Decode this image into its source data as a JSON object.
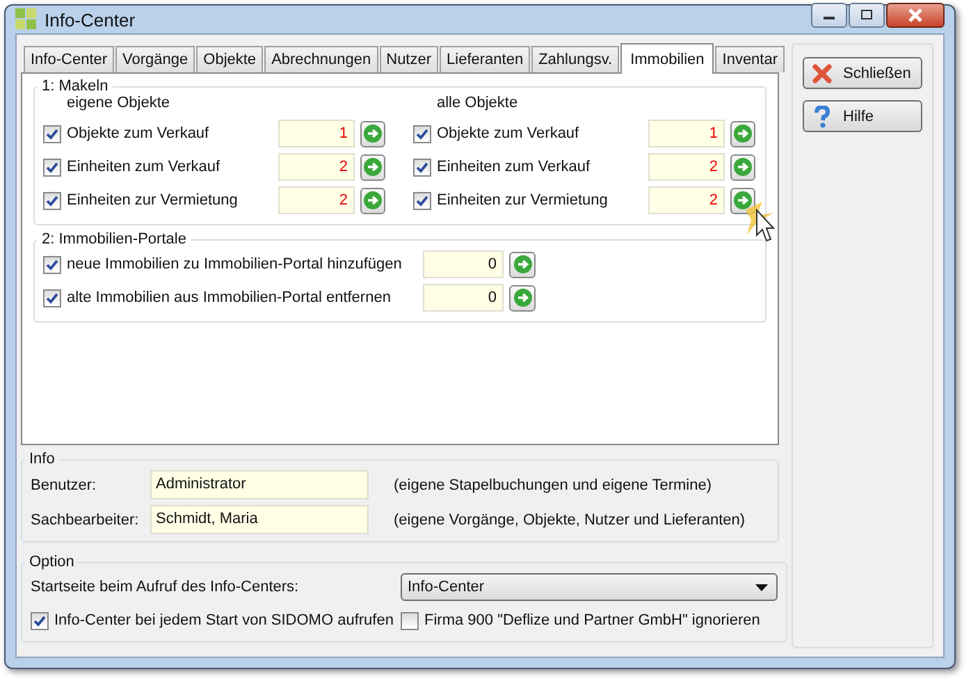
{
  "window": {
    "title": "Info-Center"
  },
  "tabs": [
    {
      "label": "Info-Center",
      "selected": false
    },
    {
      "label": "Vorgänge",
      "selected": false
    },
    {
      "label": "Objekte",
      "selected": false
    },
    {
      "label": "Abrechnungen",
      "selected": false
    },
    {
      "label": "Nutzer",
      "selected": false
    },
    {
      "label": "Lieferanten",
      "selected": false
    },
    {
      "label": "Zahlungsv.",
      "selected": false
    },
    {
      "label": "Immobilien",
      "selected": true
    },
    {
      "label": "Inventar",
      "selected": false
    }
  ],
  "makeln": {
    "title": "1: Makeln",
    "columns": [
      {
        "heading": "eigene Objekte",
        "rows": [
          {
            "label": "Objekte zum Verkauf",
            "checked": true,
            "value": "1"
          },
          {
            "label": "Einheiten zum Verkauf",
            "checked": true,
            "value": "2"
          },
          {
            "label": "Einheiten zur Vermietung",
            "checked": true,
            "value": "2"
          }
        ]
      },
      {
        "heading": "alle Objekte",
        "rows": [
          {
            "label": "Objekte zum Verkauf",
            "checked": true,
            "value": "1"
          },
          {
            "label": "Einheiten zum Verkauf",
            "checked": true,
            "value": "2"
          },
          {
            "label": "Einheiten zur Vermietung",
            "checked": true,
            "value": "2"
          }
        ]
      }
    ]
  },
  "portale": {
    "title": "2: Immobilien-Portale",
    "rows": [
      {
        "label": "neue Immobilien zu Immobilien-Portal hinzufügen",
        "checked": true,
        "value": "0"
      },
      {
        "label": "alte Immobilien aus Immobilien-Portal entfernen",
        "checked": true,
        "value": "0"
      }
    ]
  },
  "info": {
    "title": "Info",
    "fields": [
      {
        "label": "Benutzer:",
        "value": "Administrator",
        "note": "(eigene Stapelbuchungen und eigene Termine)"
      },
      {
        "label": "Sachbearbeiter:",
        "value": "Schmidt, Maria",
        "note": "(eigene Vorgänge, Objekte, Nutzer und Lieferanten)"
      }
    ]
  },
  "option": {
    "title": "Option",
    "start_label": "Startseite beim Aufruf des Info-Centers:",
    "start_value": "Info-Center",
    "checkboxes": [
      {
        "label": "Info-Center bei jedem Start von SIDOMO aufrufen",
        "checked": true
      },
      {
        "label": "Firma 900 \"Deflize und Partner GmbH\" ignorieren",
        "checked": false
      }
    ]
  },
  "buttons": [
    {
      "label": "Schließen",
      "kind": "close"
    },
    {
      "label": "Hilfe",
      "kind": "help"
    }
  ]
}
